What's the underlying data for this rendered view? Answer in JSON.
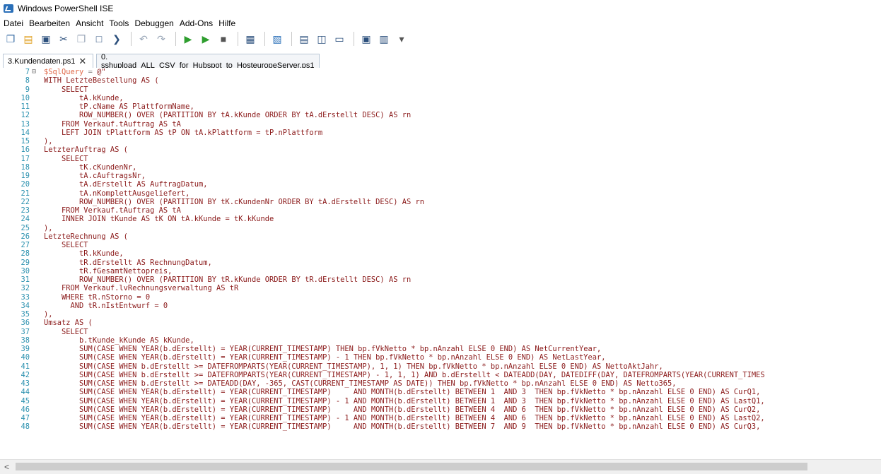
{
  "window": {
    "title": "Windows PowerShell ISE"
  },
  "menu": [
    "Datei",
    "Bearbeiten",
    "Ansicht",
    "Tools",
    "Debuggen",
    "Add-Ons",
    "Hilfe"
  ],
  "toolbar": [
    {
      "icon": "new-file-icon",
      "glyph": "❐",
      "color": "#3a6ea5"
    },
    {
      "icon": "open-folder-icon",
      "glyph": "▤",
      "color": "#e0a020"
    },
    {
      "icon": "save-icon",
      "glyph": "▣",
      "color": "#2b4f7c"
    },
    {
      "icon": "cut-icon",
      "glyph": "✂",
      "color": "#2b4f7c"
    },
    {
      "icon": "copy-icon",
      "glyph": "❐",
      "color": "#9aa7b8"
    },
    {
      "icon": "paste-icon",
      "glyph": "□",
      "color": "#2b4f7c"
    },
    {
      "icon": "clear-console-icon",
      "glyph": "❯",
      "color": "#2b4f7c"
    },
    {
      "sep": true
    },
    {
      "icon": "undo-icon",
      "glyph": "↶",
      "color": "#9aa7b8"
    },
    {
      "icon": "redo-icon",
      "glyph": "↷",
      "color": "#9aa7b8"
    },
    {
      "sep": true
    },
    {
      "icon": "run-script-icon",
      "glyph": "▶",
      "color": "#2f9e2f"
    },
    {
      "icon": "run-selection-icon",
      "glyph": "▶",
      "color": "#2f9e2f"
    },
    {
      "icon": "stop-icon",
      "glyph": "■",
      "color": "#555555"
    },
    {
      "sep": true
    },
    {
      "icon": "remote-powershell-icon",
      "glyph": "▦",
      "color": "#2b4f7c"
    },
    {
      "sep": true
    },
    {
      "icon": "powershell-console-icon",
      "glyph": "▧",
      "color": "#2a6fb8"
    },
    {
      "sep": true
    },
    {
      "icon": "show-script-top-icon",
      "glyph": "▤",
      "color": "#2b4f7c"
    },
    {
      "icon": "show-script-right-icon",
      "glyph": "◫",
      "color": "#2b4f7c"
    },
    {
      "icon": "show-script-max-icon",
      "glyph": "▭",
      "color": "#2b4f7c"
    },
    {
      "sep": true
    },
    {
      "icon": "command-addon-icon",
      "glyph": "▣",
      "color": "#2b4f7c"
    },
    {
      "icon": "show-commands-icon",
      "glyph": "▥",
      "color": "#2b4f7c"
    },
    {
      "icon": "toolbar-overflow-icon",
      "glyph": "▾",
      "color": "#555555"
    }
  ],
  "tabs": [
    {
      "label": "3.Kundendaten.ps1",
      "active": true,
      "close": "✕"
    },
    {
      "label": "0. sshupload_ALL_CSV_for_Hubspot_to_HosteuropeServer.ps1",
      "active": false
    }
  ],
  "code": [
    {
      "n": "7",
      "fold": "⊟",
      "var": "$SqlQuery",
      "op": " = ",
      "t": "@\""
    },
    {
      "n": "8",
      "t": "WITH LetzteBestellung AS ("
    },
    {
      "n": "9",
      "t": "    SELECT"
    },
    {
      "n": "10",
      "t": "        tA.kKunde,"
    },
    {
      "n": "11",
      "t": "        tP.cName AS PlattformName,"
    },
    {
      "n": "12",
      "t": "        ROW_NUMBER() OVER (PARTITION BY tA.kKunde ORDER BY tA.dErstellt DESC) AS rn"
    },
    {
      "n": "13",
      "t": "    FROM Verkauf.tAuftrag AS tA"
    },
    {
      "n": "14",
      "t": "    LEFT JOIN tPlattform AS tP ON tA.kPlattform = tP.nPlattform"
    },
    {
      "n": "15",
      "t": "),"
    },
    {
      "n": "16",
      "t": "LetzterAuftrag AS ("
    },
    {
      "n": "17",
      "t": "    SELECT"
    },
    {
      "n": "18",
      "t": "        tK.cKundenNr,"
    },
    {
      "n": "19",
      "t": "        tA.cAuftragsNr,"
    },
    {
      "n": "20",
      "t": "        tA.dErstellt AS AuftragDatum,"
    },
    {
      "n": "21",
      "t": "        tA.nKomplettAusgeliefert,"
    },
    {
      "n": "22",
      "t": "        ROW_NUMBER() OVER (PARTITION BY tK.cKundenNr ORDER BY tA.dErstellt DESC) AS rn"
    },
    {
      "n": "23",
      "t": "    FROM Verkauf.tAuftrag AS tA"
    },
    {
      "n": "24",
      "t": "    INNER JOIN tKunde AS tK ON tA.kKunde = tK.kKunde"
    },
    {
      "n": "25",
      "t": "),"
    },
    {
      "n": "26",
      "t": "LetzteRechnung AS ("
    },
    {
      "n": "27",
      "t": "    SELECT"
    },
    {
      "n": "28",
      "t": "        tR.kKunde,"
    },
    {
      "n": "29",
      "t": "        tR.dErstellt AS RechnungDatum,"
    },
    {
      "n": "30",
      "t": "        tR.fGesamtNettopreis,"
    },
    {
      "n": "31",
      "t": "        ROW_NUMBER() OVER (PARTITION BY tR.kKunde ORDER BY tR.dErstellt DESC) AS rn"
    },
    {
      "n": "32",
      "t": "    FROM Verkauf.lvRechnungsverwaltung AS tR"
    },
    {
      "n": "33",
      "t": "    WHERE tR.nStorno = 0"
    },
    {
      "n": "34",
      "t": "      AND tR.nIstEntwurf = 0"
    },
    {
      "n": "35",
      "t": "),"
    },
    {
      "n": "36",
      "t": "Umsatz AS ("
    },
    {
      "n": "37",
      "t": "    SELECT"
    },
    {
      "n": "38",
      "t": "        b.tKunde_kKunde AS kKunde,"
    },
    {
      "n": "39",
      "t": "        SUM(CASE WHEN YEAR(b.dErstellt) = YEAR(CURRENT_TIMESTAMP) THEN bp.fVkNetto * bp.nAnzahl ELSE 0 END) AS NetCurrentYear,"
    },
    {
      "n": "40",
      "t": "        SUM(CASE WHEN YEAR(b.dErstellt) = YEAR(CURRENT_TIMESTAMP) - 1 THEN bp.fVkNetto * bp.nAnzahl ELSE 0 END) AS NetLastYear,"
    },
    {
      "n": "41",
      "t": "        SUM(CASE WHEN b.dErstellt >= DATEFROMPARTS(YEAR(CURRENT_TIMESTAMP), 1, 1) THEN bp.fVkNetto * bp.nAnzahl ELSE 0 END) AS NettoAktJahr,"
    },
    {
      "n": "42",
      "t": "        SUM(CASE WHEN b.dErstellt >= DATEFROMPARTS(YEAR(CURRENT_TIMESTAMP) - 1, 1, 1) AND b.dErstellt < DATEADD(DAY, DATEDIFF(DAY, DATEFROMPARTS(YEAR(CURRENT_TIMES"
    },
    {
      "n": "43",
      "t": "        SUM(CASE WHEN b.dErstellt >= DATEADD(DAY, -365, CAST(CURRENT_TIMESTAMP AS DATE)) THEN bp.fVkNetto * bp.nAnzahl ELSE 0 END) AS Netto365,"
    },
    {
      "n": "44",
      "t": "        SUM(CASE WHEN YEAR(b.dErstellt) = YEAR(CURRENT_TIMESTAMP)     AND MONTH(b.dErstellt) BETWEEN 1  AND 3  THEN bp.fVkNetto * bp.nAnzahl ELSE 0 END) AS CurQ1,"
    },
    {
      "n": "45",
      "t": "        SUM(CASE WHEN YEAR(b.dErstellt) = YEAR(CURRENT_TIMESTAMP) - 1 AND MONTH(b.dErstellt) BETWEEN 1  AND 3  THEN bp.fVkNetto * bp.nAnzahl ELSE 0 END) AS LastQ1,"
    },
    {
      "n": "46",
      "t": "        SUM(CASE WHEN YEAR(b.dErstellt) = YEAR(CURRENT_TIMESTAMP)     AND MONTH(b.dErstellt) BETWEEN 4  AND 6  THEN bp.fVkNetto * bp.nAnzahl ELSE 0 END) AS CurQ2,"
    },
    {
      "n": "47",
      "t": "        SUM(CASE WHEN YEAR(b.dErstellt) = YEAR(CURRENT_TIMESTAMP) - 1 AND MONTH(b.dErstellt) BETWEEN 4  AND 6  THEN bp.fVkNetto * bp.nAnzahl ELSE 0 END) AS LastQ2,"
    },
    {
      "n": "48",
      "t": "        SUM(CASE WHEN YEAR(b.dErstellt) = YEAR(CURRENT_TIMESTAMP)     AND MONTH(b.dErstellt) BETWEEN 7  AND 9  THEN bp.fVkNetto * bp.nAnzahl ELSE 0 END) AS CurQ3,"
    }
  ],
  "scrollbar": {
    "left_arrow": "<"
  },
  "colors": {
    "code_text": "#8b1a1a",
    "variable": "#e06a4a",
    "line_numbers": "#2b91af",
    "run_green": "#2f9e2f"
  }
}
